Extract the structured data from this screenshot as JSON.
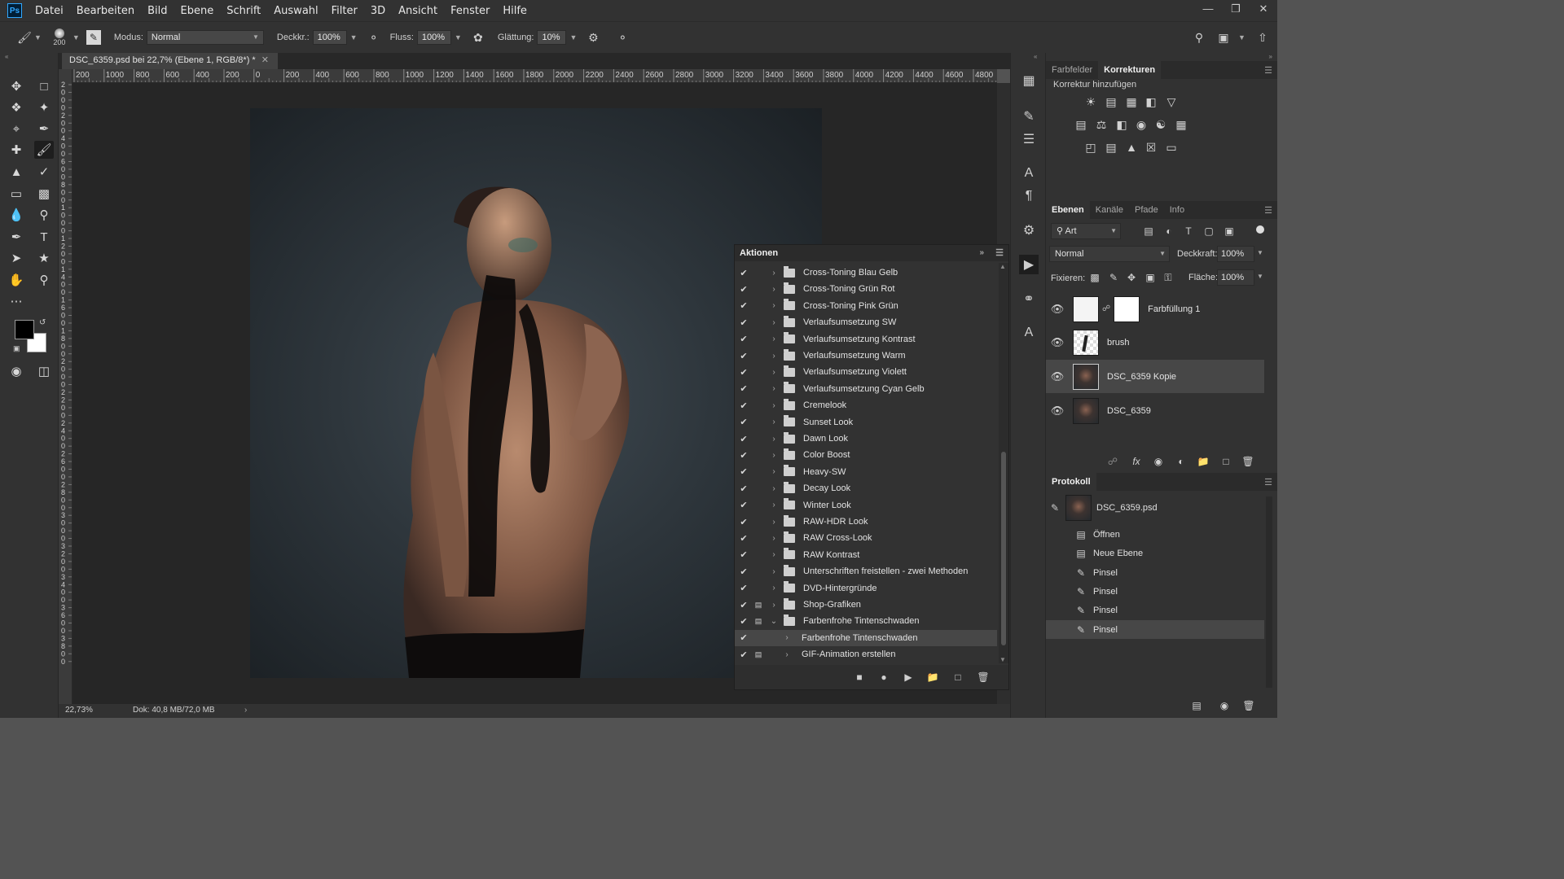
{
  "menubar": {
    "logo": "Ps",
    "items": [
      "Datei",
      "Bearbeiten",
      "Bild",
      "Ebene",
      "Schrift",
      "Auswahl",
      "Filter",
      "3D",
      "Ansicht",
      "Fenster",
      "Hilfe"
    ]
  },
  "options": {
    "brush_size": "200",
    "mode_label": "Modus:",
    "mode_value": "Normal",
    "opacity_label": "Deckkr.:",
    "opacity_value": "100%",
    "flow_label": "Fluss:",
    "flow_value": "100%",
    "smoothing_label": "Glättung:",
    "smoothing_value": "10%"
  },
  "document": {
    "tab_title": "DSC_6359.psd bei 22,7% (Ebene 1, RGB/8*) *",
    "ruler_h_labels": [
      "200",
      "1000",
      "800",
      "600",
      "400",
      "200",
      "0",
      "200",
      "400",
      "600",
      "800",
      "1000",
      "1200",
      "1400",
      "1600",
      "1800",
      "2000",
      "2200",
      "2400",
      "2600",
      "2800",
      "3000",
      "3200",
      "3400",
      "3600",
      "3800",
      "4000",
      "4200",
      "4400",
      "4600",
      "4800"
    ],
    "ruler_v_digits": [
      "2",
      "0",
      "0",
      "0",
      "2",
      "0",
      "0",
      "4",
      "0",
      "0",
      "6",
      "0",
      "0",
      "8",
      "0",
      "0",
      "1",
      "0",
      "0",
      "0",
      "1",
      "2",
      "0",
      "0",
      "1",
      "4",
      "0",
      "0",
      "1",
      "6",
      "0",
      "0",
      "1",
      "8",
      "0",
      "0",
      "2",
      "0",
      "0",
      "0",
      "2",
      "2",
      "0",
      "0",
      "2",
      "4",
      "0",
      "0",
      "2",
      "6",
      "0",
      "0",
      "2",
      "8",
      "0",
      "0",
      "3",
      "0",
      "0",
      "0",
      "3",
      "2",
      "0",
      "0",
      "3",
      "4",
      "0",
      "0",
      "3",
      "6",
      "0",
      "0",
      "3",
      "8",
      "0",
      "0"
    ],
    "zoom": "22,73%",
    "doc_size": "Dok: 40,8 MB/72,0 MB"
  },
  "right_panels": {
    "top_tabs": [
      "Farbfelder",
      "Korrekturen"
    ],
    "korrektur_title": "Korrektur hinzufügen",
    "layers_tabs": [
      "Ebenen",
      "Kanäle",
      "Pfade",
      "Info"
    ],
    "filter_kind": "Art",
    "blend_mode": "Normal",
    "opacity_label": "Deckkraft:",
    "opacity_value": "100%",
    "lock_label": "Fixieren:",
    "fill_label": "Fläche:",
    "fill_value": "100%",
    "layers": [
      {
        "name": "Farbfüllung 1"
      },
      {
        "name": "brush"
      },
      {
        "name": "DSC_6359 Kopie"
      },
      {
        "name": "DSC_6359"
      }
    ],
    "history_title": "Protokoll",
    "history_snapshot": "DSC_6359.psd",
    "history": [
      "Öffnen",
      "Neue Ebene",
      "Pinsel",
      "Pinsel",
      "Pinsel",
      "Pinsel"
    ]
  },
  "actions_panel": {
    "title": "Aktionen",
    "items": [
      "Cross-Toning Blau Gelb",
      "Cross-Toning Grün Rot",
      "Cross-Toning Pink Grün",
      "Verlaufsumsetzung SW",
      "Verlaufsumsetzung Kontrast",
      "Verlaufsumsetzung Warm",
      "Verlaufsumsetzung Violett",
      "Verlaufsumsetzung Cyan Gelb",
      "Cremelook",
      "Sunset Look",
      "Dawn Look",
      "Color Boost",
      "Heavy-SW",
      "Decay Look",
      "Winter Look",
      "RAW-HDR Look",
      "RAW Cross-Look",
      "RAW Kontrast",
      "Unterschriften freistellen - zwei Methoden",
      "DVD-Hintergründe",
      "Shop-Grafiken",
      "Farbenfrohe Tintenschwaden",
      "Farbenfrohe Tintenschwaden",
      "GIF-Animation erstellen"
    ]
  }
}
